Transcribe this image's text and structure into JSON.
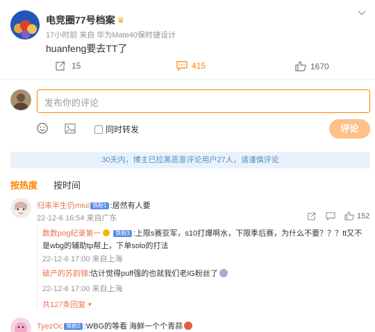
{
  "post": {
    "author": "电竞圈77号档案",
    "meta": "17小时前 来自 华为Mate40保时捷设计",
    "text": "huanfeng要去TT了",
    "repost_count": "15",
    "comment_count": "415",
    "like_count": "1670"
  },
  "composer": {
    "placeholder": "发布你的评论",
    "also_repost": "同时转发",
    "submit": "评论"
  },
  "notice": "30天内，博主已拉黑恶意评论用户27人，请谨慎评论",
  "sort_tabs": {
    "hot": "按热度",
    "time": "按时间"
  },
  "comments": [
    {
      "user": "归来半生仍miui",
      "badge": "铁粉1",
      "text": ":居然有人要",
      "meta": "22-12-6 16:54 来自广东",
      "like_count": "152",
      "replies": [
        {
          "user": "数数pog纪录第一",
          "badge": "铁粉3",
          "text": ":上限s赛亚军，s10打爆啊水，下限季后赛，为什么不要？？？tt又不是wbg的辅助tp帮上，下单solo的打法",
          "meta": "22-12-6 17:00 来自上海"
        },
        {
          "user": "破产的苏韵锦",
          "text": ":估计觉得puff强的也就我们老IG粉丝了",
          "meta": "22-12-6 17:00 来自上海"
        }
      ],
      "more_replies": "共127条回复"
    },
    {
      "user": "TyezOc",
      "badge": "铁粉2",
      "text": ":WBG的等看 海鲜一个个青蒜"
    }
  ],
  "colors": {
    "accent": "#ff8200",
    "link": "#eb7350",
    "notice_bg": "#e9f2fb",
    "notice_text": "#4d90c9"
  }
}
